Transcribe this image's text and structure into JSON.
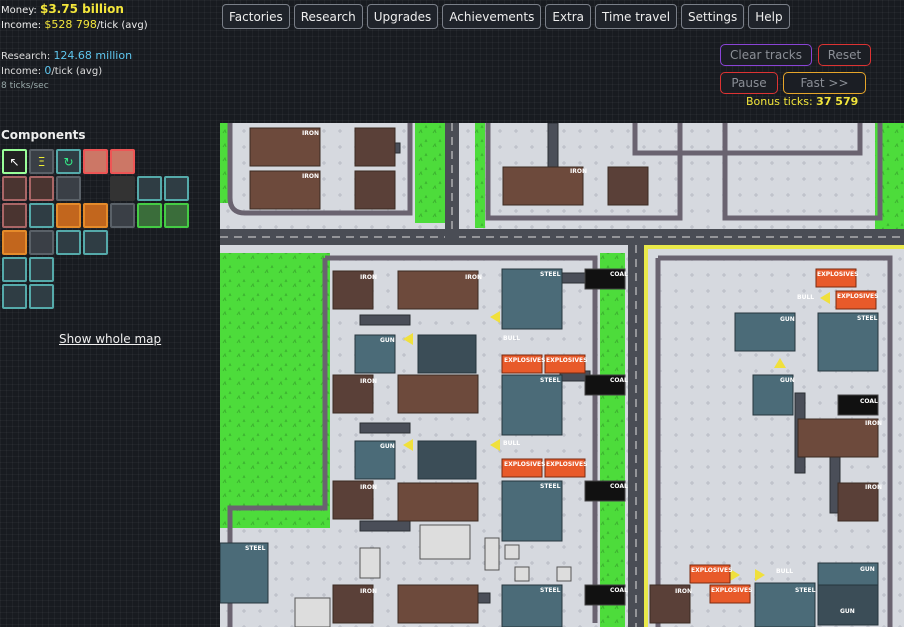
{
  "stats": {
    "money_label": "Money:",
    "money_value": "$3.75 billion",
    "income_label": "Income:",
    "income_value": "$528 798",
    "income_unit": "/tick (avg)",
    "research_label": "Research:",
    "research_value": "124.68 million",
    "research_income_label": "Income:",
    "research_income_value": "0",
    "research_income_unit": "/tick (avg)",
    "tick_rate": "8 ticks/sec"
  },
  "menu": [
    "Factories",
    "Research",
    "Upgrades",
    "Achievements",
    "Extra",
    "Time travel",
    "Settings",
    "Help"
  ],
  "controls": {
    "clear_tracks": "Clear tracks",
    "reset": "Reset",
    "pause": "Pause",
    "fast": "Fast >>",
    "bonus_label": "Bonus ticks:",
    "bonus_value": "37 579"
  },
  "components": {
    "title": "Components",
    "show_map": "Show whole map"
  },
  "map_labels": {
    "iron": "IRON",
    "steel": "STEEL",
    "coal": "COAL",
    "gun": "GUN",
    "bull": "BULL",
    "explosives": "EXPLOSIVES"
  },
  "colors": {
    "grass": "#4ddc3b",
    "floor": "#d6d9df",
    "wall": "#6a6370",
    "road": "#4a4d55",
    "iron_box": "#6d4a3c",
    "steel_box": "#4b6b78",
    "explosives_box": "#e85a2a",
    "coal_box": "#111111"
  }
}
